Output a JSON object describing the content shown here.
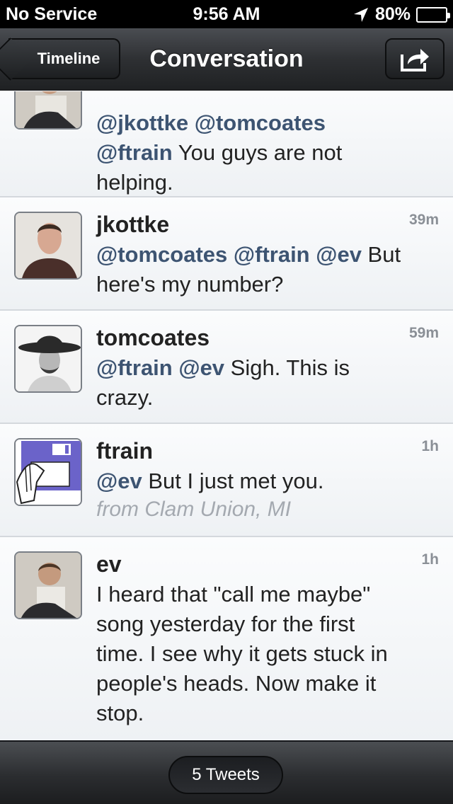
{
  "status_bar": {
    "carrier": "No Service",
    "time": "9:56 AM",
    "battery": "80%",
    "battery_level": 0.8
  },
  "nav": {
    "back_label": "Timeline",
    "title": "Conversation",
    "share_icon": "share-icon"
  },
  "tweets": [
    {
      "username": "",
      "age": "",
      "mentions": "@jkottke @tomcoates",
      "mentions2": "@ftrain",
      "text": " You guys are not",
      "text2": "helping."
    },
    {
      "username": "jkottke",
      "age": "39m",
      "mentions": "@tomcoates @ftrain @ev",
      "text": " But",
      "text2": "here's my number?"
    },
    {
      "username": "tomcoates",
      "age": "59m",
      "mentions": "@ftrain @ev",
      "text": " Sigh. This is",
      "text2": "crazy."
    },
    {
      "username": "ftrain",
      "age": "1h",
      "mentions": "@ev",
      "text": " But I just met you.",
      "from": "from Clam Union, MI"
    },
    {
      "username": "ev",
      "age": "1h",
      "lines": [
        "I heard that \"call me maybe\"",
        "song yesterday for the first",
        "time. I see why it gets stuck in",
        "people's heads. Now make it",
        "stop."
      ]
    }
  ],
  "bottom_bar": {
    "count_label": "5 Tweets"
  }
}
